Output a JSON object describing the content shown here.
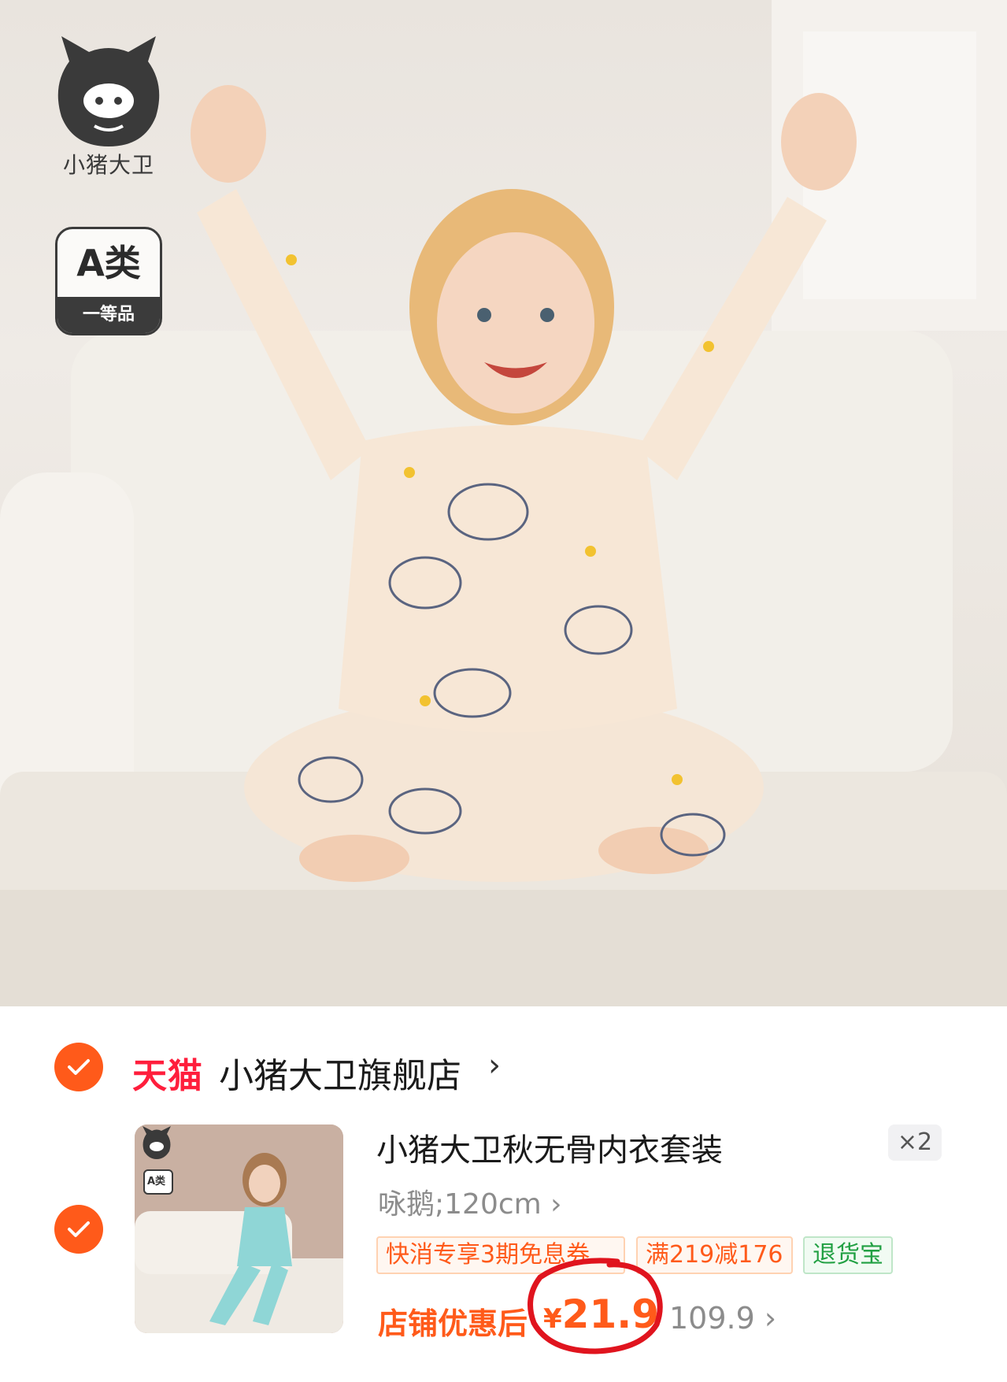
{
  "hero": {
    "brand_logo_text": "小猪大卫",
    "grade_badge": {
      "main": "A类",
      "sub": "一等品"
    }
  },
  "order": {
    "platform": "天猫",
    "store_name": "小猪大卫旗舰店",
    "store_chevron": "›",
    "product_title": "小猪大卫秋无骨内衣套装",
    "quantity": "×2",
    "variant": "咏鹅;120cm ›",
    "thumb_badge": "A类",
    "tags": [
      {
        "label": "快消专享3期免息券",
        "style": "orange"
      },
      {
        "label": "满219减176",
        "style": "orange"
      },
      {
        "label": "退货宝",
        "style": "green"
      }
    ],
    "price_label": "店铺优惠后",
    "price_symbol": "¥",
    "price": "21.9",
    "original_price": "109.9 ›"
  },
  "colors": {
    "accent": "#ff5a1a",
    "tmall": "#ff1e3c",
    "annotation": "#e0141e"
  }
}
